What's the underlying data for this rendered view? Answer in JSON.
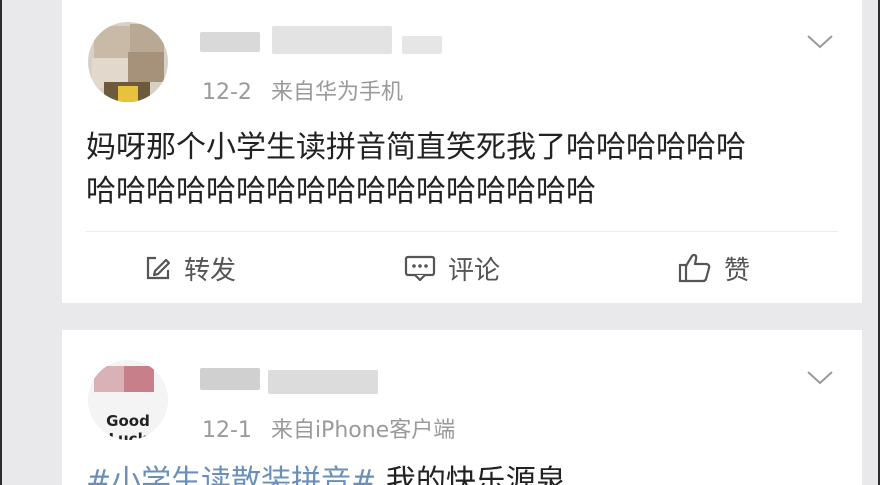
{
  "posts": [
    {
      "username": "",
      "date": "12-2",
      "source": "来自华为手机",
      "content_lines": [
        "妈呀那个小学生读拼音简直笑死我了哈哈哈哈哈哈",
        "哈哈哈哈哈哈哈哈哈哈哈哈哈哈哈哈哈"
      ],
      "actions": {
        "repost": "转发",
        "comment": "评论",
        "like": "赞"
      },
      "avatar_text": ""
    },
    {
      "username": "",
      "date": "12-1",
      "source": "来自iPhone客户端",
      "avatar_text": "Good Luck",
      "content_topic": "#小学生读散装拼音#",
      "content_rest": " 我的快乐源泉"
    }
  ],
  "icons": {
    "expand": "chevron-down-icon",
    "repost": "edit-square-icon",
    "comment": "comment-bubble-icon",
    "like": "thumbs-up-icon"
  }
}
